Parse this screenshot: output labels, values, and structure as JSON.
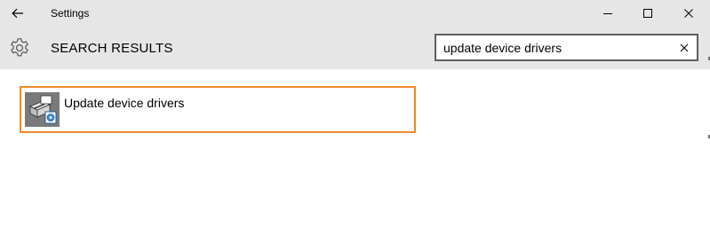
{
  "window": {
    "title": "Settings"
  },
  "header": {
    "heading": "SEARCH RESULTS"
  },
  "search": {
    "value": "update device drivers",
    "placeholder": ""
  },
  "results": [
    {
      "label": "Update device drivers",
      "icon": "device-manager-icon"
    }
  ],
  "colors": {
    "header_bg": "#e6e6e6",
    "highlight_border": "#f08a2c",
    "search_border": "#5f5f5f"
  },
  "icons": {
    "back": "back-arrow-icon",
    "minimize": "minimize-icon",
    "maximize": "maximize-icon",
    "close": "close-icon",
    "settings": "gear-icon",
    "clear": "clear-icon"
  }
}
